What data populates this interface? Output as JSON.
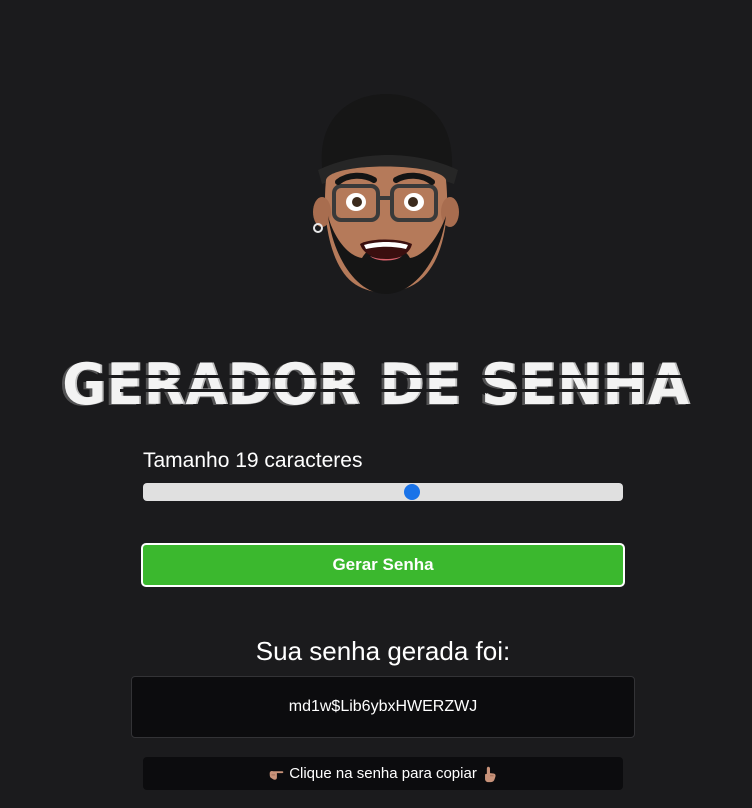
{
  "avatar": {
    "icon": "memoji-avatar-icon"
  },
  "title": "GERADOR DE SENHA",
  "length": {
    "label": "Tamanho 19 caracteres",
    "value": 19,
    "slider_position": 0.56
  },
  "generate_button": {
    "label": "Gerar Senha",
    "color": "#3bb82e"
  },
  "result": {
    "heading": "Sua senha gerada foi:",
    "password": "md1w$Lib6ybxHWERZWJ"
  },
  "copy_hint": {
    "text": "Clique na senha para copiar",
    "icon_left": "pointing-right-hand-icon",
    "icon_right": "pointing-up-hand-icon"
  },
  "colors": {
    "background": "#1b1b1d",
    "slider_track": "#e0e0e0",
    "slider_thumb": "#1a73e8",
    "password_box": "#0c0c0e"
  }
}
